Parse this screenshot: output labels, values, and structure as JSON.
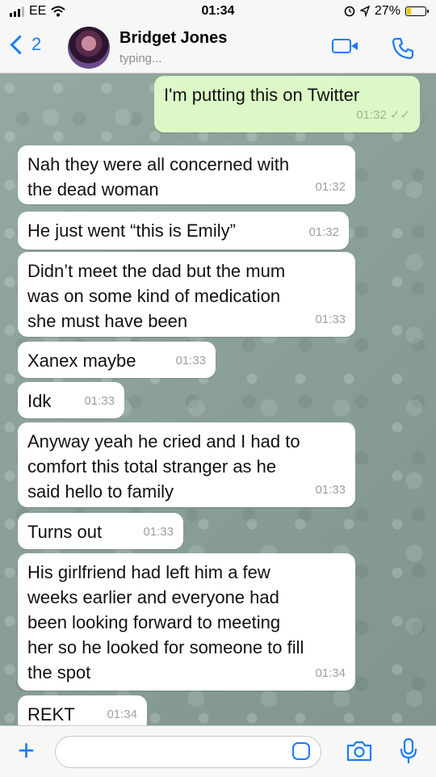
{
  "status_bar": {
    "carrier": "EE",
    "time": "01:34",
    "battery_percent": "27%",
    "battery_level": 0.27,
    "icons": [
      "signal-icon",
      "wifi-icon",
      "alarm-icon",
      "location-icon",
      "battery-icon"
    ]
  },
  "header": {
    "back_count": "2",
    "contact_name": "Bridget Jones",
    "status": "typing...",
    "icons": [
      "back-chevron-icon",
      "avatar",
      "video-call-icon",
      "voice-call-icon"
    ]
  },
  "messages": [
    {
      "dir": "out",
      "text": "I'm putting this on Twitter",
      "time": "01:32"
    },
    {
      "dir": "in",
      "text": "Nah they were all concerned with\nthe dead woman",
      "time": "01:32"
    },
    {
      "dir": "in",
      "text": "He just went “this is Emily”",
      "time": "01:32"
    },
    {
      "dir": "in",
      "text": "Didn’t meet the dad but the mum\nwas on some kind of medication\nshe must have been",
      "time": "01:33"
    },
    {
      "dir": "in",
      "text": "Xanex maybe",
      "time": "01:33"
    },
    {
      "dir": "in",
      "text": "Idk",
      "time": "01:33"
    },
    {
      "dir": "in",
      "text": "Anyway yeah he cried and I had to\ncomfort this total stranger as he\nsaid hello to family",
      "time": "01:33"
    },
    {
      "dir": "in",
      "text": "Turns out",
      "time": "01:33"
    },
    {
      "dir": "in",
      "text": "His girlfriend had left him a few\nweeks earlier and everyone had\nbeen looking forward to meeting\nher so he looked for someone to fill\nthe spot",
      "time": "01:34"
    },
    {
      "dir": "in",
      "text": "REKT",
      "time": "01:34"
    }
  ],
  "input_bar": {
    "plus": "+",
    "placeholder": "",
    "icons": [
      "plus-icon",
      "sticker-icon",
      "camera-icon",
      "microphone-icon"
    ]
  },
  "colors": {
    "accent": "#1a7cf4",
    "outgoing_bubble": "#dcf8c6",
    "incoming_bubble": "#ffffff",
    "chat_background": "#8fa39b"
  }
}
